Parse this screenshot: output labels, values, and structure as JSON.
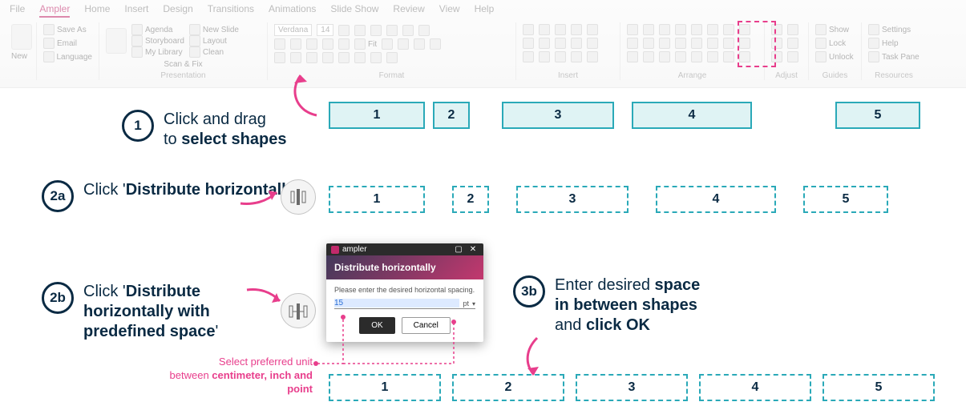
{
  "ribbon": {
    "tabs": [
      "File",
      "Ampler",
      "Home",
      "Insert",
      "Design",
      "Transitions",
      "Animations",
      "Slide Show",
      "Review",
      "View",
      "Help"
    ],
    "active_tab": "Ampler",
    "groups": {
      "new_label": "New",
      "file_items": {
        "save_as": "Save As",
        "email": "Email",
        "language": "Language"
      },
      "presentation": {
        "label": "Presentation",
        "scan_fix": "Scan & Fix",
        "agenda": "Agenda",
        "storyboard": "Storyboard",
        "my_library": "My Library",
        "new_slide": "New Slide",
        "layout": "Layout",
        "clean": "Clean"
      },
      "format": {
        "label": "Format",
        "font": "Verdana",
        "size": "14",
        "fit": "Fit"
      },
      "insert": {
        "label": "Insert"
      },
      "arrange": {
        "label": "Arrange"
      },
      "adjust": {
        "label": "Adjust"
      },
      "guides": {
        "label": "Guides",
        "show": "Show",
        "lock": "Lock",
        "unlock": "Unlock"
      },
      "resources": {
        "label": "Resources",
        "settings": "Settings",
        "help": "Help",
        "taskpane": "Task Pane"
      }
    }
  },
  "steps": {
    "s1": {
      "badge": "1",
      "line1": "Click and drag",
      "line2_prefix": "to ",
      "line2_bold": "select shapes"
    },
    "s2a": {
      "badge": "2a",
      "prefix": "Click '",
      "bold": "Distribute horizontally",
      "suffix": "'"
    },
    "s2b": {
      "badge": "2b",
      "prefix": "Click '",
      "bold": "Distribute horizontally with predefined space",
      "suffix": "'"
    },
    "s3b": {
      "badge": "3b",
      "l1_pre": "Enter desired ",
      "l1_bold": "space",
      "l2_bold": "in between shapes",
      "l3_pre": "and ",
      "l3_bold": "click OK"
    }
  },
  "shapes": {
    "row1": [
      "1",
      "2",
      "3",
      "4",
      "5"
    ],
    "row2": [
      "1",
      "2",
      "3",
      "4",
      "5"
    ],
    "row3": [
      "1",
      "2",
      "3",
      "4",
      "5"
    ]
  },
  "dialog": {
    "app": "ampler",
    "title": "Distribute horizontally",
    "prompt": "Please enter the desired horizontal spacing.",
    "value": "15",
    "unit": "pt",
    "ok": "OK",
    "cancel": "Cancel"
  },
  "hint": {
    "l1": "Select preferred unit",
    "l2_pre": "between ",
    "l2_bold": "centimeter, inch and point"
  }
}
